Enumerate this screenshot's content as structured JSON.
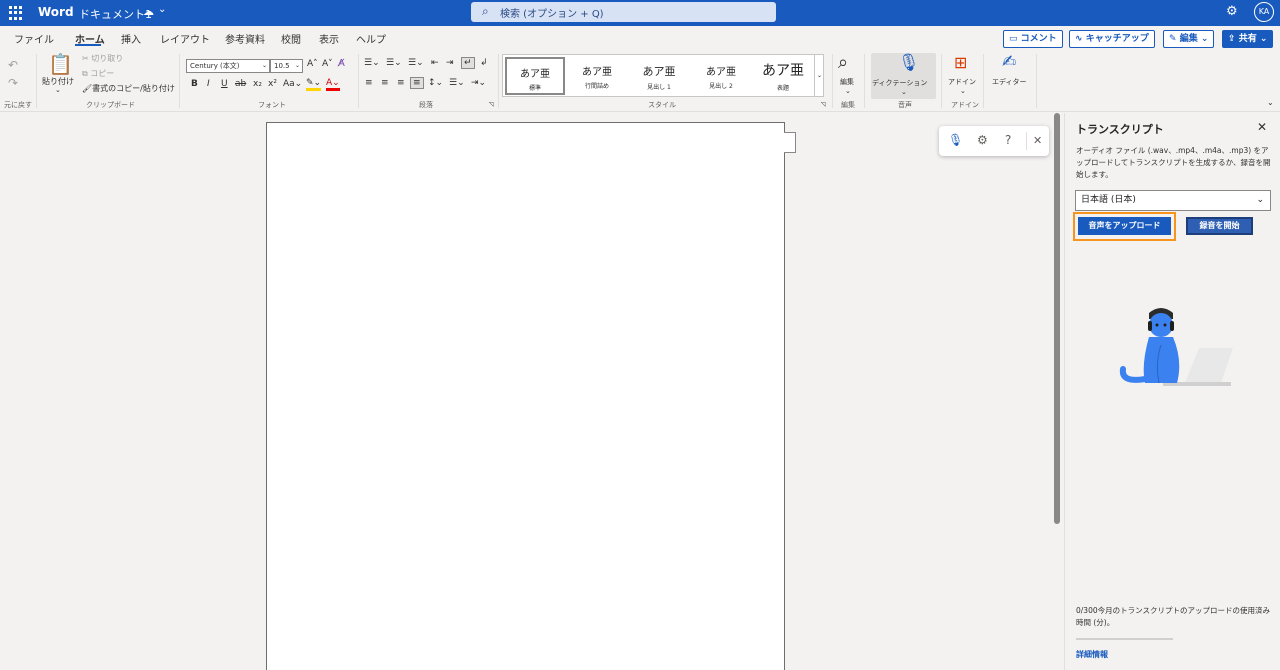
{
  "titlebar": {
    "app_name": "Word",
    "doc_name": "ドキュメント1",
    "search_placeholder": "検索 (オプション + Q)",
    "avatar": "KA"
  },
  "tabs": [
    "ファイル",
    "ホーム",
    "挿入",
    "レイアウト",
    "参考資料",
    "校閲",
    "表示",
    "ヘルプ"
  ],
  "active_tab": "ホーム",
  "ribbon_right": {
    "comment": "コメント",
    "catchup": "キャッチアップ",
    "editing": "編集",
    "share": "共有"
  },
  "ribbon": {
    "undo_label": "元に戻す",
    "paste": "貼り付け",
    "cut": "切り取り",
    "copy": "コピー",
    "format_painter": "書式のコピー/貼り付け",
    "clipboard_group": "クリップボード",
    "font_name": "Century (本文)",
    "font_size": "10.5",
    "font_group": "フォント",
    "paragraph_group": "段落",
    "style_group": "スタイル",
    "styles": [
      {
        "big": "あア亜",
        "small": "標準"
      },
      {
        "big": "あア亜",
        "small": "行間詰め"
      },
      {
        "big": "あア亜",
        "small": "見出し 1"
      },
      {
        "big": "あア亜",
        "small": "見出し 2"
      },
      {
        "big": "あア亜",
        "small": "表題"
      }
    ],
    "editing_btn": "編集",
    "editing_group": "編集",
    "dictate_btn": "ディクテーション",
    "voice_group": "音声",
    "addin_btn": "アドイン",
    "addin_group": "アドイン",
    "editor_btn": "エディター"
  },
  "pane": {
    "title": "トランスクリプト",
    "description": "オーディオ ファイル (.wav、.mp4、.m4a、.mp3) をアップロードしてトランスクリプトを生成するか、録音を開始します。",
    "language": "日本語 (日本)",
    "upload_btn": "音声をアップロード",
    "record_btn": "録音を開始",
    "usage": "0/300今月のトランスクリプトのアップロードの使用済み時間 (分)。",
    "usage_fraction": 0,
    "link": "詳細情報"
  },
  "colors": {
    "brand": "#185abd",
    "highlight": "#f7941d"
  }
}
